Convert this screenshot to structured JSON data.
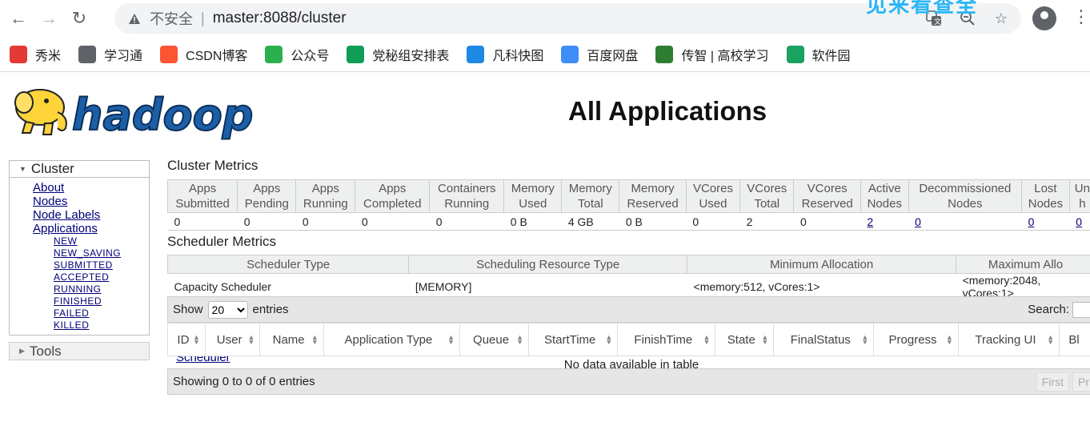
{
  "browser": {
    "insecure_label": "不安全",
    "url": "master:8088/cluster",
    "overlay_text": "见来看查全"
  },
  "bookmarks": [
    {
      "label": "秀米",
      "icon": "xiumi-icon",
      "color": "#e53935"
    },
    {
      "label": "学习通",
      "icon": "globe-icon",
      "color": "#5f6368"
    },
    {
      "label": "CSDN博客",
      "icon": "csdn-icon",
      "color": "#fc5531"
    },
    {
      "label": "公众号",
      "icon": "wechat-icon",
      "color": "#2dae4f"
    },
    {
      "label": "党秘组安排表",
      "icon": "sheet-icon",
      "color": "#0f9d58"
    },
    {
      "label": "凡科快图",
      "icon": "fanke-icon",
      "color": "#1e88e5"
    },
    {
      "label": "百度网盘",
      "icon": "baidu-pan-icon",
      "color": "#3d8ef7"
    },
    {
      "label": "传智 | 高校学习",
      "icon": "chuanzhi-icon",
      "color": "#2e7d32"
    },
    {
      "label": "软件园",
      "icon": "ruanjian-icon",
      "color": "#1aa260"
    }
  ],
  "page": {
    "logo_text": "hadoop",
    "title": "All Applications"
  },
  "sidebar": {
    "cluster_label": "Cluster",
    "links": [
      "About",
      "Nodes",
      "Node Labels",
      "Applications"
    ],
    "app_states": [
      "NEW",
      "NEW_SAVING",
      "SUBMITTED",
      "ACCEPTED",
      "RUNNING",
      "FINISHED",
      "FAILED",
      "KILLED"
    ],
    "scheduler_link": "Scheduler",
    "tools_label": "Tools"
  },
  "cluster_metrics": {
    "title": "Cluster Metrics",
    "headers": [
      [
        "Apps",
        "Submitted"
      ],
      [
        "Apps",
        "Pending"
      ],
      [
        "Apps",
        "Running"
      ],
      [
        "Apps",
        "Completed"
      ],
      [
        "Containers",
        "Running"
      ],
      [
        "Memory",
        "Used"
      ],
      [
        "Memory",
        "Total"
      ],
      [
        "Memory",
        "Reserved"
      ],
      [
        "VCores",
        "Used"
      ],
      [
        "VCores",
        "Total"
      ],
      [
        "VCores",
        "Reserved"
      ],
      [
        "Active",
        "Nodes"
      ],
      [
        "Decommissioned",
        "Nodes"
      ],
      [
        "Lost",
        "Nodes"
      ],
      [
        "Un",
        "h"
      ]
    ],
    "values": [
      "0",
      "0",
      "0",
      "0",
      "0",
      "0 B",
      "4 GB",
      "0 B",
      "0",
      "2",
      "0",
      "2",
      "0",
      "0",
      "0"
    ],
    "links": [
      false,
      false,
      false,
      false,
      false,
      false,
      false,
      false,
      false,
      false,
      false,
      true,
      true,
      true,
      true
    ]
  },
  "scheduler_metrics": {
    "title": "Scheduler Metrics",
    "headers": [
      "Scheduler Type",
      "Scheduling Resource Type",
      "Minimum Allocation",
      "Maximum Allo"
    ],
    "values": [
      "Capacity Scheduler",
      "[MEMORY]",
      "<memory:512, vCores:1>",
      "<memory:2048, vCores:1>"
    ]
  },
  "apps_table": {
    "show_label": "Show",
    "page_size": "20",
    "entries_label": "entries",
    "search_label": "Search:",
    "headers": [
      "ID",
      "User",
      "Name",
      "Application Type",
      "Queue",
      "StartTime",
      "FinishTime",
      "State",
      "FinalStatus",
      "Progress",
      "Tracking UI",
      "Bl"
    ],
    "empty_text": "No data available in table",
    "info_text": "Showing 0 to 0 of 0 entries",
    "pager": [
      "First",
      "Pr"
    ]
  }
}
